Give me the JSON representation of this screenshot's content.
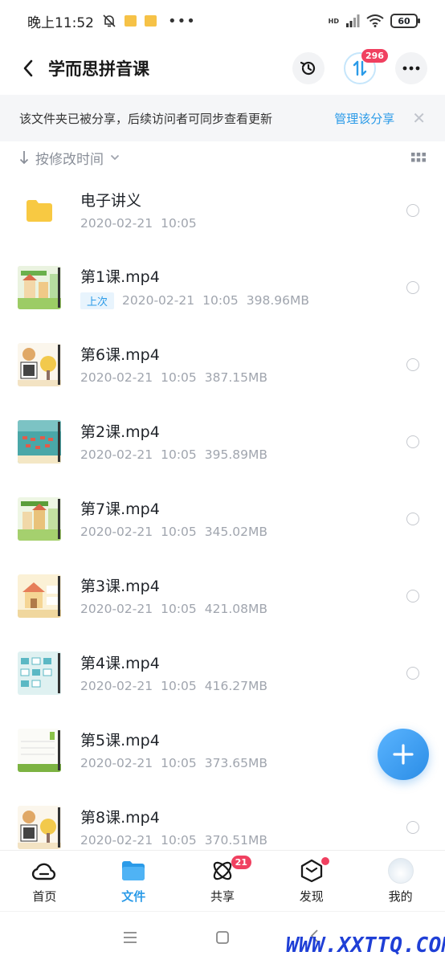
{
  "status_bar": {
    "time": "晚上11:52",
    "hd": "HD",
    "battery": "60"
  },
  "header": {
    "title": "学而思拼音课",
    "transfer_badge": "296"
  },
  "share_banner": {
    "message": "该文件夹已被分享，后续访问者可同步查看更新",
    "manage_link": "管理该分享",
    "close": "✕"
  },
  "sort": {
    "label": "按修改时间"
  },
  "files": [
    {
      "name": "电子讲义",
      "date": "2020-02-21",
      "time": "10:05",
      "size": "",
      "tag": "",
      "type": "folder"
    },
    {
      "name": "第1课.mp4",
      "date": "2020-02-21",
      "time": "10:05",
      "size": "398.96MB",
      "tag": "上次",
      "type": "video"
    },
    {
      "name": "第6课.mp4",
      "date": "2020-02-21",
      "time": "10:05",
      "size": "387.15MB",
      "tag": "",
      "type": "video"
    },
    {
      "name": "第2课.mp4",
      "date": "2020-02-21",
      "time": "10:05",
      "size": "395.89MB",
      "tag": "",
      "type": "video"
    },
    {
      "name": "第7课.mp4",
      "date": "2020-02-21",
      "time": "10:05",
      "size": "345.02MB",
      "tag": "",
      "type": "video"
    },
    {
      "name": "第3课.mp4",
      "date": "2020-02-21",
      "time": "10:05",
      "size": "421.08MB",
      "tag": "",
      "type": "video"
    },
    {
      "name": "第4课.mp4",
      "date": "2020-02-21",
      "time": "10:05",
      "size": "416.27MB",
      "tag": "",
      "type": "video"
    },
    {
      "name": "第5课.mp4",
      "date": "2020-02-21",
      "time": "10:05",
      "size": "373.65MB",
      "tag": "",
      "type": "video"
    },
    {
      "name": "第8课.mp4",
      "date": "2020-02-21",
      "time": "10:05",
      "size": "370.51MB",
      "tag": "",
      "type": "video"
    }
  ],
  "nav": [
    {
      "label": "首页",
      "icon": "cloud-icon",
      "active": false
    },
    {
      "label": "文件",
      "icon": "folder-icon",
      "active": true
    },
    {
      "label": "共享",
      "icon": "atom-icon",
      "active": false,
      "badge": "21"
    },
    {
      "label": "发现",
      "icon": "cube-icon",
      "active": false,
      "dot": true
    },
    {
      "label": "我的",
      "icon": "avatar-icon",
      "active": false
    }
  ],
  "watermark": "WWW.XXTTQ.COM",
  "colors": {
    "accent": "#2b9be8",
    "badge": "#f04060",
    "folder": "#f8c942"
  }
}
